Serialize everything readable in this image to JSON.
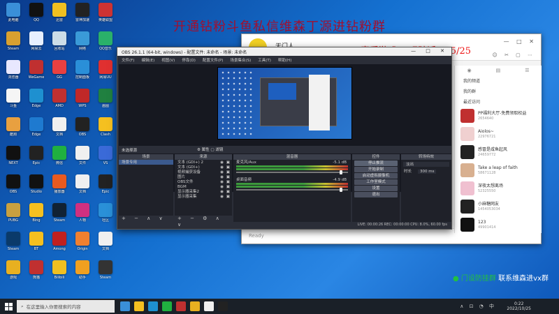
{
  "overlay": {
    "title": "开通钻粉斗鱼私信维森丁源进钻粉群",
    "subtitle": "素质游戏 不玩赃话1 25/25",
    "wechat_prefix": "门设防挂群",
    "wechat_text": "联系维森进vx群"
  },
  "desktop": {
    "icons": [
      {
        "label": "此电脑",
        "color": "#3a8fd8"
      },
      {
        "label": "QQ",
        "color": "#111"
      },
      {
        "label": "迅雷",
        "color": "#f0c020"
      },
      {
        "label": "雷神加速",
        "color": "#222"
      },
      {
        "label": "英雄联盟",
        "color": "#c33"
      },
      {
        "label": "Steam",
        "color": "#d8a030"
      },
      {
        "label": "网易云",
        "color": "#e8f0ff"
      },
      {
        "label": "回收站",
        "color": "#ccdde8"
      },
      {
        "label": "网络",
        "color": "#3a9ad8"
      },
      {
        "label": "QQ音乐",
        "color": "#2ab06a"
      },
      {
        "label": "浏览器",
        "color": "#e8e8ff"
      },
      {
        "label": "WeGame",
        "color": "#c03030"
      },
      {
        "label": "GG",
        "color": "#e84040"
      },
      {
        "label": "控制面板",
        "color": "#2a8fd8"
      },
      {
        "label": "网易UU",
        "color": "#e03030"
      },
      {
        "label": "斗鱼",
        "color": "#f5f5f5"
      },
      {
        "label": "Edge",
        "color": "#1e90d0"
      },
      {
        "label": "AMD",
        "color": "#c03030"
      },
      {
        "label": "WPS",
        "color": "#c02828"
      },
      {
        "label": "画图",
        "color": "#208040"
      },
      {
        "label": "酷狗",
        "color": "#e8a040"
      },
      {
        "label": "Edge",
        "color": "#1e7ad0"
      },
      {
        "label": "文档",
        "color": "#f0f0f0"
      },
      {
        "label": "OBS",
        "color": "#222"
      },
      {
        "label": "Clash",
        "color": "#f5c020"
      },
      {
        "label": "NEXT",
        "color": "#111"
      },
      {
        "label": "Epic",
        "color": "#222"
      },
      {
        "label": "微信",
        "color": "#20b040"
      },
      {
        "label": "文件",
        "color": "#f0f0f0"
      },
      {
        "label": "VS",
        "color": "#3a6ad8"
      },
      {
        "label": "OBS",
        "color": "#111"
      },
      {
        "label": "Studio",
        "color": "#111"
      },
      {
        "label": "播放器",
        "color": "#e85a20"
      },
      {
        "label": "文档",
        "color": "#f0f0f0"
      },
      {
        "label": "Epic",
        "color": "#222"
      },
      {
        "label": "PUBG",
        "color": "#c8a040"
      },
      {
        "label": "Bing",
        "color": "#f5c020"
      },
      {
        "label": "Steam",
        "color": "#123"
      },
      {
        "label": "人物",
        "color": "#d03080"
      },
      {
        "label": "社区",
        "color": "#2a90d8"
      },
      {
        "label": "Steam",
        "color": "#0a3a6a"
      },
      {
        "label": "BT",
        "color": "#f5c020"
      },
      {
        "label": "Among",
        "color": "#c02020"
      },
      {
        "label": "Origin",
        "color": "#f08030"
      },
      {
        "label": "文档",
        "color": "#f0f0f0"
      },
      {
        "label": "游戏",
        "color": "#e8b020"
      },
      {
        "label": "熊猫",
        "color": "#c03030"
      },
      {
        "label": "Bilibili",
        "color": "#f0c020"
      },
      {
        "label": "助手",
        "color": "#f0a020"
      },
      {
        "label": "Steam",
        "color": "#333"
      }
    ]
  },
  "chat": {
    "contact_name": "无门人",
    "input_placeholder": "Ready",
    "window_controls": "— □ ✕",
    "toolbar_icons": "☺ ✂ ▢ ⋯",
    "panel_tabs": [
      "◉",
      "▤",
      "☰"
    ],
    "panel_menu": [
      "我的频道",
      "我的群",
      "最近访问"
    ],
    "panel_items": [
      {
        "title": "PP福利大厅-免费领取权益",
        "sub": "2654640",
        "color": "#c03030"
      },
      {
        "title": "Aiolos~",
        "sub": "22976721",
        "color": "#f0d0d0"
      },
      {
        "title": "感冒是咸鱼起风",
        "sub": "24659772",
        "color": "#222"
      },
      {
        "title": "Take a leap of faith",
        "sub": "58671128",
        "color": "#d8b090"
      },
      {
        "title": "深夜太想离场",
        "sub": "52325550",
        "color": "#f0c0d0"
      },
      {
        "title": "小麻糖网友",
        "sub": "1454053034",
        "color": "#222"
      },
      {
        "title": "123",
        "sub": "49901414",
        "color": "#111"
      }
    ]
  },
  "obs": {
    "title": "OBS 26.1.1 (64-bit, windows) - 配置文件: 未命名 - 场景: 未命名",
    "window_controls": "— □ ✕",
    "menu": [
      "文件(F)",
      "编辑(E)",
      "视图(V)",
      "停靠(D)",
      "配置文件(P)",
      "场景集合(S)",
      "工具(T)",
      "帮助(H)"
    ],
    "scene_bar_label": "未选择源",
    "scene_bar_buttons": "⚙ 属性  ▢ 滤镜",
    "docks": {
      "scenes": {
        "title": "场景",
        "items": [
          "场景专用"
        ]
      },
      "sources": {
        "title": "来源",
        "items": [
          "文本 (GDI+) 2",
          "文本 (GDI+)",
          "视频捕获设备",
          "图片",
          "OBS文件",
          "BGM",
          "显示器采集2",
          "显示器采集"
        ]
      },
      "mixer": {
        "title": "混音器",
        "channels": [
          {
            "name": "麦克风/Aux",
            "db": "-5.1 dB"
          },
          {
            "name": "桌面音频",
            "db": "-4.9 dB"
          }
        ]
      },
      "controls": {
        "title": "控件",
        "buttons": [
          "停止推流",
          "开始录制",
          "启动虚拟摄像机",
          "工作室模式",
          "设置",
          "退出"
        ]
      },
      "transitions": {
        "title": "转场特效",
        "type": "淡出",
        "duration_label": "时长",
        "duration": "300 ms"
      }
    },
    "footer_buttons": "+ − ∧ ∨",
    "footer_buttons_sources": "+ − ⚙ ∧ ∨",
    "status": "LIVE: 00:00:26   REC: 00:00:00   CPU: 8.0%, 60.00 fps"
  },
  "taskbar": {
    "search_placeholder": "在这里输入你要搜索的内容",
    "apps": [
      "#3a8fd8",
      "#f5c020",
      "#1e90d0",
      "#20b040",
      "#c03030",
      "#e8b020",
      "#f0f0f0",
      "#222"
    ],
    "tray_icons": "∧ ⊡ ◔ 中",
    "time": "0:22",
    "date": "2022/10/25"
  }
}
